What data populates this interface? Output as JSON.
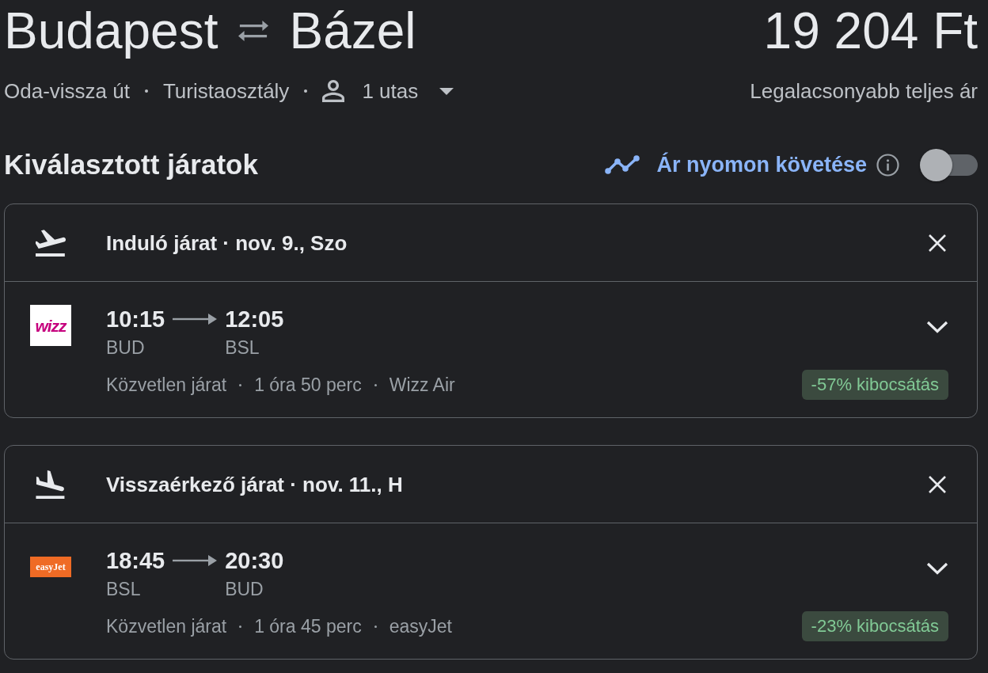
{
  "route": {
    "origin": "Budapest",
    "destination": "Bázel"
  },
  "price": "19 204 Ft",
  "trip": {
    "type": "Oda-vissza út",
    "cabin": "Turistaosztály",
    "passengers": "1 utas"
  },
  "price_note": "Legalacsonyabb teljes ár",
  "section_title": "Kiválasztott járatok",
  "price_tracking": {
    "label": "Ár nyomon követése",
    "on": false
  },
  "flights": [
    {
      "kind": "departure",
      "title": "Induló járat · nov. 9., Szo",
      "logo": {
        "kind": "square",
        "text": "wizz",
        "color": "#ffffff"
      },
      "departure_time": "10:15",
      "arrival_time": "12:05",
      "from": "BUD",
      "to": "BSL",
      "details": [
        "Közvetlen járat",
        "1 óra 50 perc",
        "Wizz Air"
      ],
      "emissions": "-57% kibocsátás",
      "expanded": false
    },
    {
      "kind": "return",
      "title": "Visszaérkező járat · nov. 11., H",
      "logo": {
        "kind": "banner",
        "text": "easyJet",
        "color": "#ef6b25"
      },
      "departure_time": "18:45",
      "arrival_time": "20:30",
      "from": "BSL",
      "to": "BUD",
      "details": [
        "Közvetlen járat",
        "1 óra 45 perc",
        "easyJet"
      ],
      "emissions": "-23% kibocsátás",
      "expanded": false
    }
  ]
}
